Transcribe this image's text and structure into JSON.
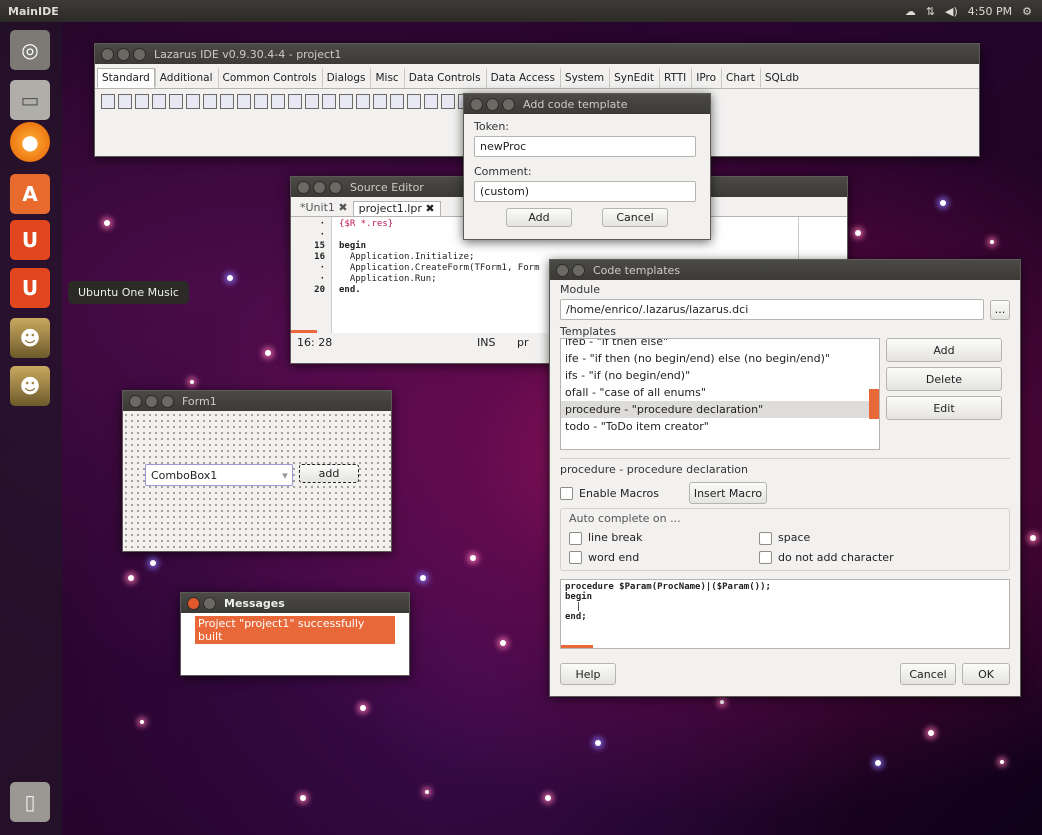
{
  "top_panel": {
    "app_name": "MainIDE",
    "clock": "4:50 PM",
    "tray_icons": [
      "cloud-icon",
      "network-icon",
      "volume-icon",
      "gear-icon"
    ]
  },
  "launcher": {
    "items": [
      {
        "name": "dash",
        "icon": "ubuntu-logo-icon",
        "color": "#8a8a8a"
      },
      {
        "name": "files",
        "icon": "files-icon",
        "color": "#9a9892"
      },
      {
        "name": "firefox",
        "icon": "firefox-icon",
        "color": "#e66000"
      },
      {
        "name": "software-center",
        "icon": "software-center-icon",
        "color": "#e86a2c"
      },
      {
        "name": "ubuntu-one",
        "icon": "ubuntu-one-icon",
        "color": "#e2461f"
      },
      {
        "name": "ubuntu-one-music",
        "icon": "ubuntu-one-music-icon",
        "color": "#e2461f"
      },
      {
        "name": "lazarus-1",
        "icon": "lazarus-icon",
        "color": "#9f8a3a"
      },
      {
        "name": "lazarus-2",
        "icon": "lazarus-icon",
        "color": "#9f8a3a"
      }
    ],
    "tooltip": "Ubuntu One Music",
    "trash_icon": "trash-icon"
  },
  "ide": {
    "title": "Lazarus IDE v0.9.30.4-4 - project1",
    "tabs": [
      "Standard",
      "Additional",
      "Common Controls",
      "Dialogs",
      "Misc",
      "Data Controls",
      "Data Access",
      "System",
      "SynEdit",
      "RTTI",
      "IPro",
      "Chart",
      "SQLdb"
    ],
    "active_tab": "Standard"
  },
  "add_template": {
    "title": "Add code template",
    "token_label": "Token:",
    "token_value": "newProc",
    "comment_label": "Comment:",
    "comment_value": "(custom)",
    "add_button": "Add",
    "cancel_button": "Cancel"
  },
  "source_editor": {
    "title": "Source Editor",
    "tabs": [
      "*Unit1",
      "project1.lpr"
    ],
    "line_numbers": [
      "·",
      "·",
      "15",
      "16",
      "·",
      "·",
      "20"
    ],
    "lines": [
      "{$R *.res}",
      "",
      "begin",
      "  Application.Initialize;",
      "  Application.CreateForm(TForm1, Form",
      "  Application.Run;",
      "end."
    ],
    "status_pos": "16: 28",
    "status_mode": "INS",
    "status_extra": "pr"
  },
  "form1": {
    "title": "Form1",
    "combo_text": "ComboBox1",
    "button_text": "add"
  },
  "messages": {
    "title": "Messages",
    "line": "Project \"project1\" successfully built"
  },
  "code_templates": {
    "title": "Code templates",
    "module_label": "Module",
    "module_path": "/home/enrico/.lazarus/lazarus.dci",
    "browse_button": "...",
    "templates_label": "Templates",
    "items": [
      "ifeb - \"if then else\"",
      "ife - \"if then (no begin/end) else (no begin/end)\"",
      "ifs - \"if (no begin/end)\"",
      "ofall - \"case of all enums\"",
      "procedure - \"procedure declaration\"",
      "todo - \"ToDo item creator\""
    ],
    "selected_index": 4,
    "add_button": "Add",
    "delete_button": "Delete",
    "edit_button": "Edit",
    "details_label": "procedure - procedure declaration",
    "enable_macros": "Enable Macros",
    "insert_macro": "Insert Macro",
    "auto_complete_label": "Auto complete on ...",
    "opt_line_break": "line break",
    "opt_space": "space",
    "opt_word_end": "word end",
    "opt_no_char": "do not add character",
    "code_line1": "procedure $Param(ProcName)|($Param());",
    "code_line2": "begin",
    "code_line3": "  |",
    "code_line4": "end;",
    "help_button": "Help",
    "cancel_button": "Cancel",
    "ok_button": "OK"
  }
}
